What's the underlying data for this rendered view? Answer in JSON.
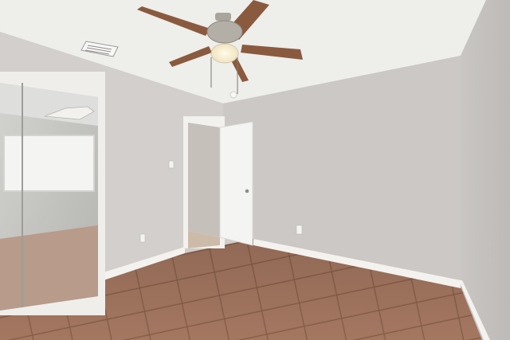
{
  "scene": {
    "kind": "photo",
    "subject": "empty-bedroom",
    "colors": {
      "wall": "#cfccc8",
      "wall_shadow": "#b9b6b3",
      "ceiling": "#efefec",
      "floor": "#9a6e55",
      "floor_grout": "#7e5844",
      "baseboard": "#f4f3f0",
      "door": "#f3f3f1",
      "fan_blade": "#8a5a3f",
      "fan_light": "#fff6d8",
      "mirror": "#bfc0be"
    }
  }
}
